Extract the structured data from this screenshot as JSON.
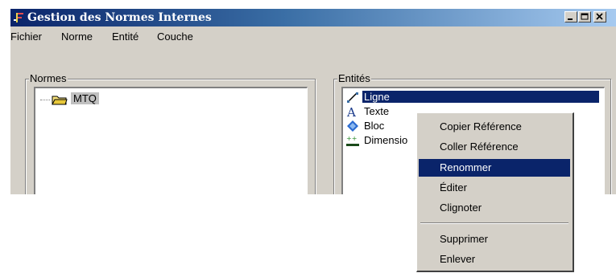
{
  "window": {
    "title": "Gestion des Normes Internes",
    "icon": "app-norms-icon",
    "controls": [
      "minimize-icon",
      "maximize-icon",
      "close-icon"
    ]
  },
  "menu": [
    "Fichier",
    "Norme",
    "Entité",
    "Couche"
  ],
  "normes": {
    "label": "Normes",
    "items": [
      {
        "label": "MTQ",
        "icon": "folder-icon"
      }
    ]
  },
  "entites": {
    "label": "Entités",
    "items": [
      {
        "label": "Ligne",
        "icon": "line-icon",
        "selected": true
      },
      {
        "label": "Texte",
        "icon": "text-icon"
      },
      {
        "label": "Bloc",
        "icon": "block-icon"
      },
      {
        "label": "Dimensio",
        "icon": "dimension-icon"
      }
    ]
  },
  "context_menu": {
    "items": [
      "Copier  Référence",
      "Coller Référence",
      "Renommer",
      "Éditer",
      "Clignoter",
      "Supprimer",
      "Enlever"
    ],
    "highlighted": "Renommer"
  },
  "colors": {
    "title_gradient_start": "#0a246a",
    "title_gradient_end": "#a6caf0",
    "selection": "#0a246a",
    "face": "#d4d0c8"
  }
}
